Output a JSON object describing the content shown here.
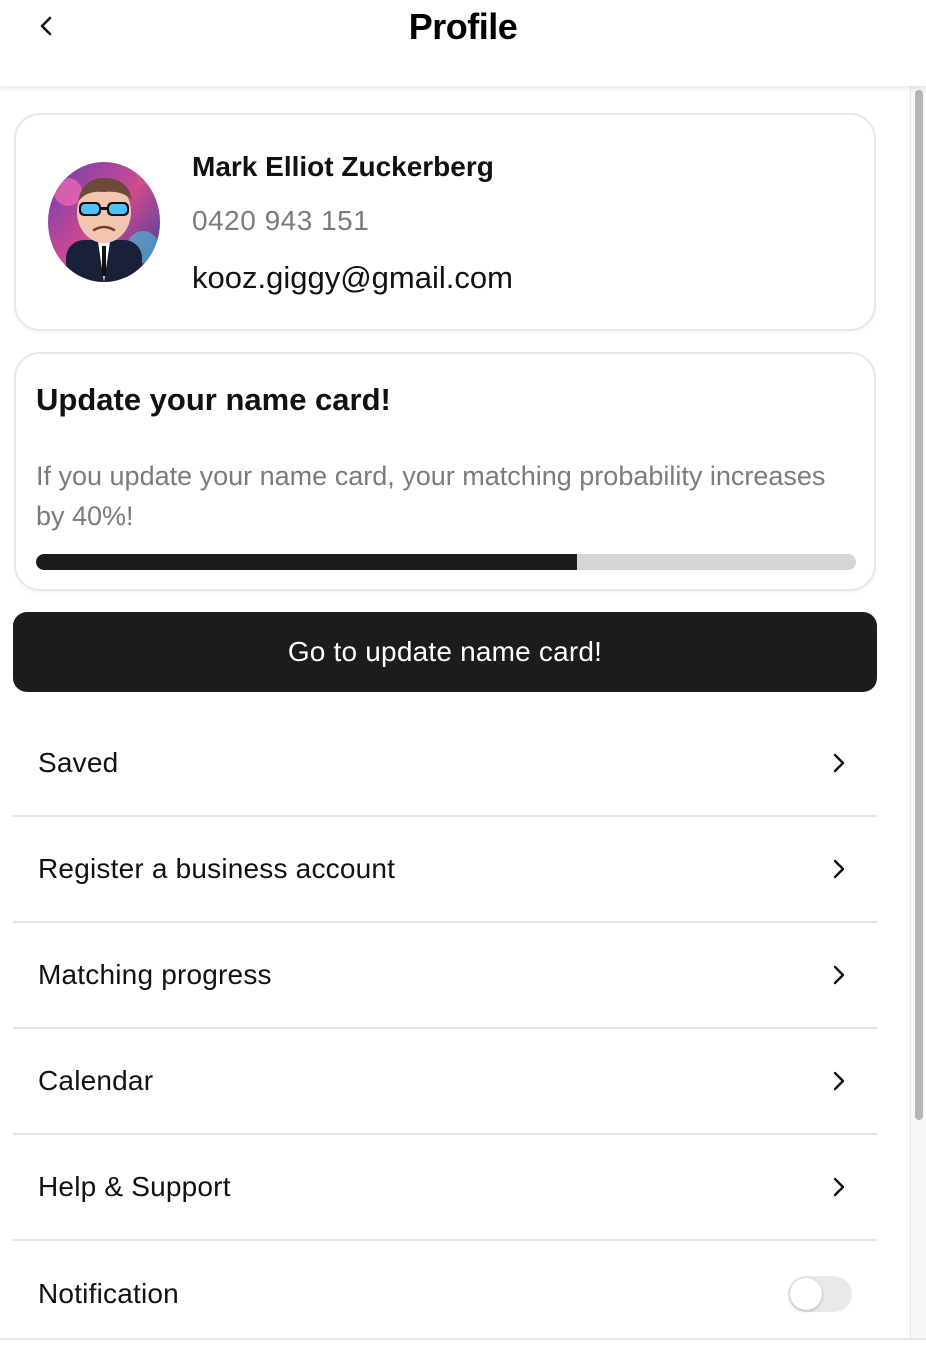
{
  "header": {
    "title": "Profile",
    "back_icon": "chevron-left-icon"
  },
  "profile": {
    "name": "Mark Elliot Zuckerberg",
    "phone": "0420 943 151",
    "email": "kooz.giggy@gmail.com",
    "avatar_icon": "cartoon-avatar-with-sunglasses"
  },
  "update_card": {
    "title": "Update your name card!",
    "description": "If you update your name card, your matching probability increases by 40%!",
    "progress_fraction": 0.66
  },
  "cta": {
    "label": "Go to update name card!"
  },
  "menu": {
    "items": [
      {
        "label": "Saved",
        "icon": "chevron-right-icon"
      },
      {
        "label": "Register a business account",
        "icon": "chevron-right-icon"
      },
      {
        "label": "Matching progress",
        "icon": "chevron-right-icon"
      },
      {
        "label": "Calendar",
        "icon": "chevron-right-icon"
      },
      {
        "label": "Help & Support",
        "icon": "chevron-right-icon"
      }
    ],
    "notification": {
      "label": "Notification",
      "enabled": false
    }
  },
  "colors": {
    "primary_dark": "#1c1c1e",
    "muted_text": "#7b7b7b",
    "progress_track": "#d5d5d5",
    "divider": "#e4e4e4"
  }
}
